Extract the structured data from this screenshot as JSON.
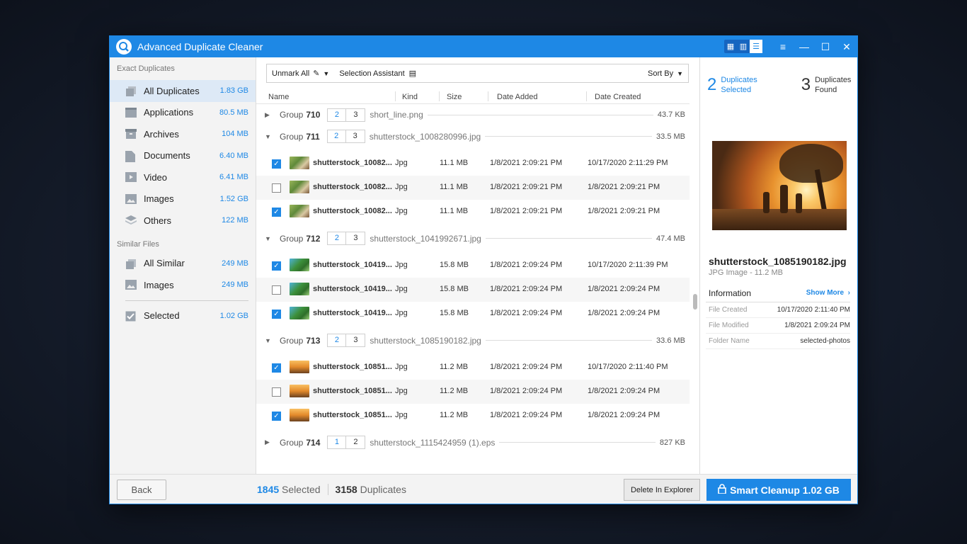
{
  "app": {
    "title": "Advanced Duplicate Cleaner",
    "accent": "#1e88e5"
  },
  "sidebar": {
    "exact_header": "Exact Duplicates",
    "exact": [
      {
        "label": "All Duplicates",
        "size": "1.83 GB",
        "icon": "copy-icon"
      },
      {
        "label": "Applications",
        "size": "80.5 MB",
        "icon": "application-icon"
      },
      {
        "label": "Archives",
        "size": "104 MB",
        "icon": "archive-icon"
      },
      {
        "label": "Documents",
        "size": "6.40 MB",
        "icon": "document-icon"
      },
      {
        "label": "Video",
        "size": "6.41 MB",
        "icon": "video-icon"
      },
      {
        "label": "Images",
        "size": "1.52 GB",
        "icon": "image-icon"
      },
      {
        "label": "Others",
        "size": "122 MB",
        "icon": "layers-icon"
      }
    ],
    "similar_header": "Similar Files",
    "similar": [
      {
        "label": "All Similar",
        "size": "249 MB",
        "icon": "copy-icon"
      },
      {
        "label": "Images",
        "size": "249 MB",
        "icon": "image-icon"
      }
    ],
    "selected": {
      "label": "Selected",
      "size": "1.02 GB",
      "icon": "checkbox-icon"
    }
  },
  "toolbar": {
    "unmark_all": "Unmark All",
    "selection_assistant": "Selection Assistant",
    "sort_by": "Sort By"
  },
  "columns": {
    "name": "Name",
    "kind": "Kind",
    "size": "Size",
    "date_added": "Date Added",
    "date_created": "Date Created"
  },
  "groups": [
    {
      "label": "Group",
      "number": "710",
      "a": "2",
      "b": "3",
      "file": "short_line.png",
      "size": "43.7 KB",
      "expanded": false,
      "files": []
    },
    {
      "label": "Group",
      "number": "711",
      "a": "2",
      "b": "3",
      "file": "shutterstock_1008280996.jpg",
      "size": "33.5 MB",
      "expanded": true,
      "files": [
        {
          "checked": true,
          "name": "shutterstock_10082...",
          "kind": "Jpg",
          "size": "11.1 MB",
          "added": "1/8/2021 2:09:21 PM",
          "created": "10/17/2020 2:11:29 PM",
          "thumb": "green"
        },
        {
          "checked": false,
          "name": "shutterstock_10082...",
          "kind": "Jpg",
          "size": "11.1 MB",
          "added": "1/8/2021 2:09:21 PM",
          "created": "1/8/2021 2:09:21 PM",
          "thumb": "green"
        },
        {
          "checked": true,
          "name": "shutterstock_10082...",
          "kind": "Jpg",
          "size": "11.1 MB",
          "added": "1/8/2021 2:09:21 PM",
          "created": "1/8/2021 2:09:21 PM",
          "thumb": "green"
        }
      ]
    },
    {
      "label": "Group",
      "number": "712",
      "a": "2",
      "b": "3",
      "file": "shutterstock_1041992671.jpg",
      "size": "47.4 MB",
      "expanded": true,
      "files": [
        {
          "checked": true,
          "name": "shutterstock_10419...",
          "kind": "Jpg",
          "size": "15.8 MB",
          "added": "1/8/2021 2:09:24 PM",
          "created": "10/17/2020 2:11:39 PM",
          "thumb": "blue"
        },
        {
          "checked": false,
          "name": "shutterstock_10419...",
          "kind": "Jpg",
          "size": "15.8 MB",
          "added": "1/8/2021 2:09:24 PM",
          "created": "1/8/2021 2:09:24 PM",
          "thumb": "blue"
        },
        {
          "checked": true,
          "name": "shutterstock_10419...",
          "kind": "Jpg",
          "size": "15.8 MB",
          "added": "1/8/2021 2:09:24 PM",
          "created": "1/8/2021 2:09:24 PM",
          "thumb": "blue"
        }
      ]
    },
    {
      "label": "Group",
      "number": "713",
      "a": "2",
      "b": "3",
      "file": "shutterstock_1085190182.jpg",
      "size": "33.6 MB",
      "expanded": true,
      "files": [
        {
          "checked": true,
          "name": "shutterstock_10851...",
          "kind": "Jpg",
          "size": "11.2 MB",
          "added": "1/8/2021 2:09:24 PM",
          "created": "10/17/2020 2:11:40 PM",
          "thumb": "sun"
        },
        {
          "checked": false,
          "name": "shutterstock_10851...",
          "kind": "Jpg",
          "size": "11.2 MB",
          "added": "1/8/2021 2:09:24 PM",
          "created": "1/8/2021 2:09:24 PM",
          "thumb": "sun"
        },
        {
          "checked": true,
          "name": "shutterstock_10851...",
          "kind": "Jpg",
          "size": "11.2 MB",
          "added": "1/8/2021 2:09:24 PM",
          "created": "1/8/2021 2:09:24 PM",
          "thumb": "sun"
        }
      ]
    },
    {
      "label": "Group",
      "number": "714",
      "a": "1",
      "b": "2",
      "file": "shutterstock_1115424959 (1).eps",
      "size": "827 KB",
      "expanded": false,
      "files": []
    }
  ],
  "right_panel": {
    "selected_count": "2",
    "selected_label_1": "Duplicates",
    "selected_label_2": "Selected",
    "found_count": "3",
    "found_label_1": "Duplicates",
    "found_label_2": "Found",
    "file_name": "shutterstock_1085190182.jpg",
    "file_meta": "JPG Image - 11.2 MB",
    "info_title": "Information",
    "show_more": "Show More",
    "info": [
      {
        "key": "File Created",
        "value": "10/17/2020 2:11:40 PM"
      },
      {
        "key": "File Modified",
        "value": "1/8/2021 2:09:24 PM"
      },
      {
        "key": "Folder Name",
        "value": "selected-photos"
      }
    ]
  },
  "footer": {
    "back": "Back",
    "selected_count": "1845",
    "selected_label": "Selected",
    "duplicates_count": "3158",
    "duplicates_label": "Duplicates",
    "delete_in_explorer": "Delete In Explorer",
    "smart_cleanup": "Smart Cleanup 1.02 GB"
  }
}
